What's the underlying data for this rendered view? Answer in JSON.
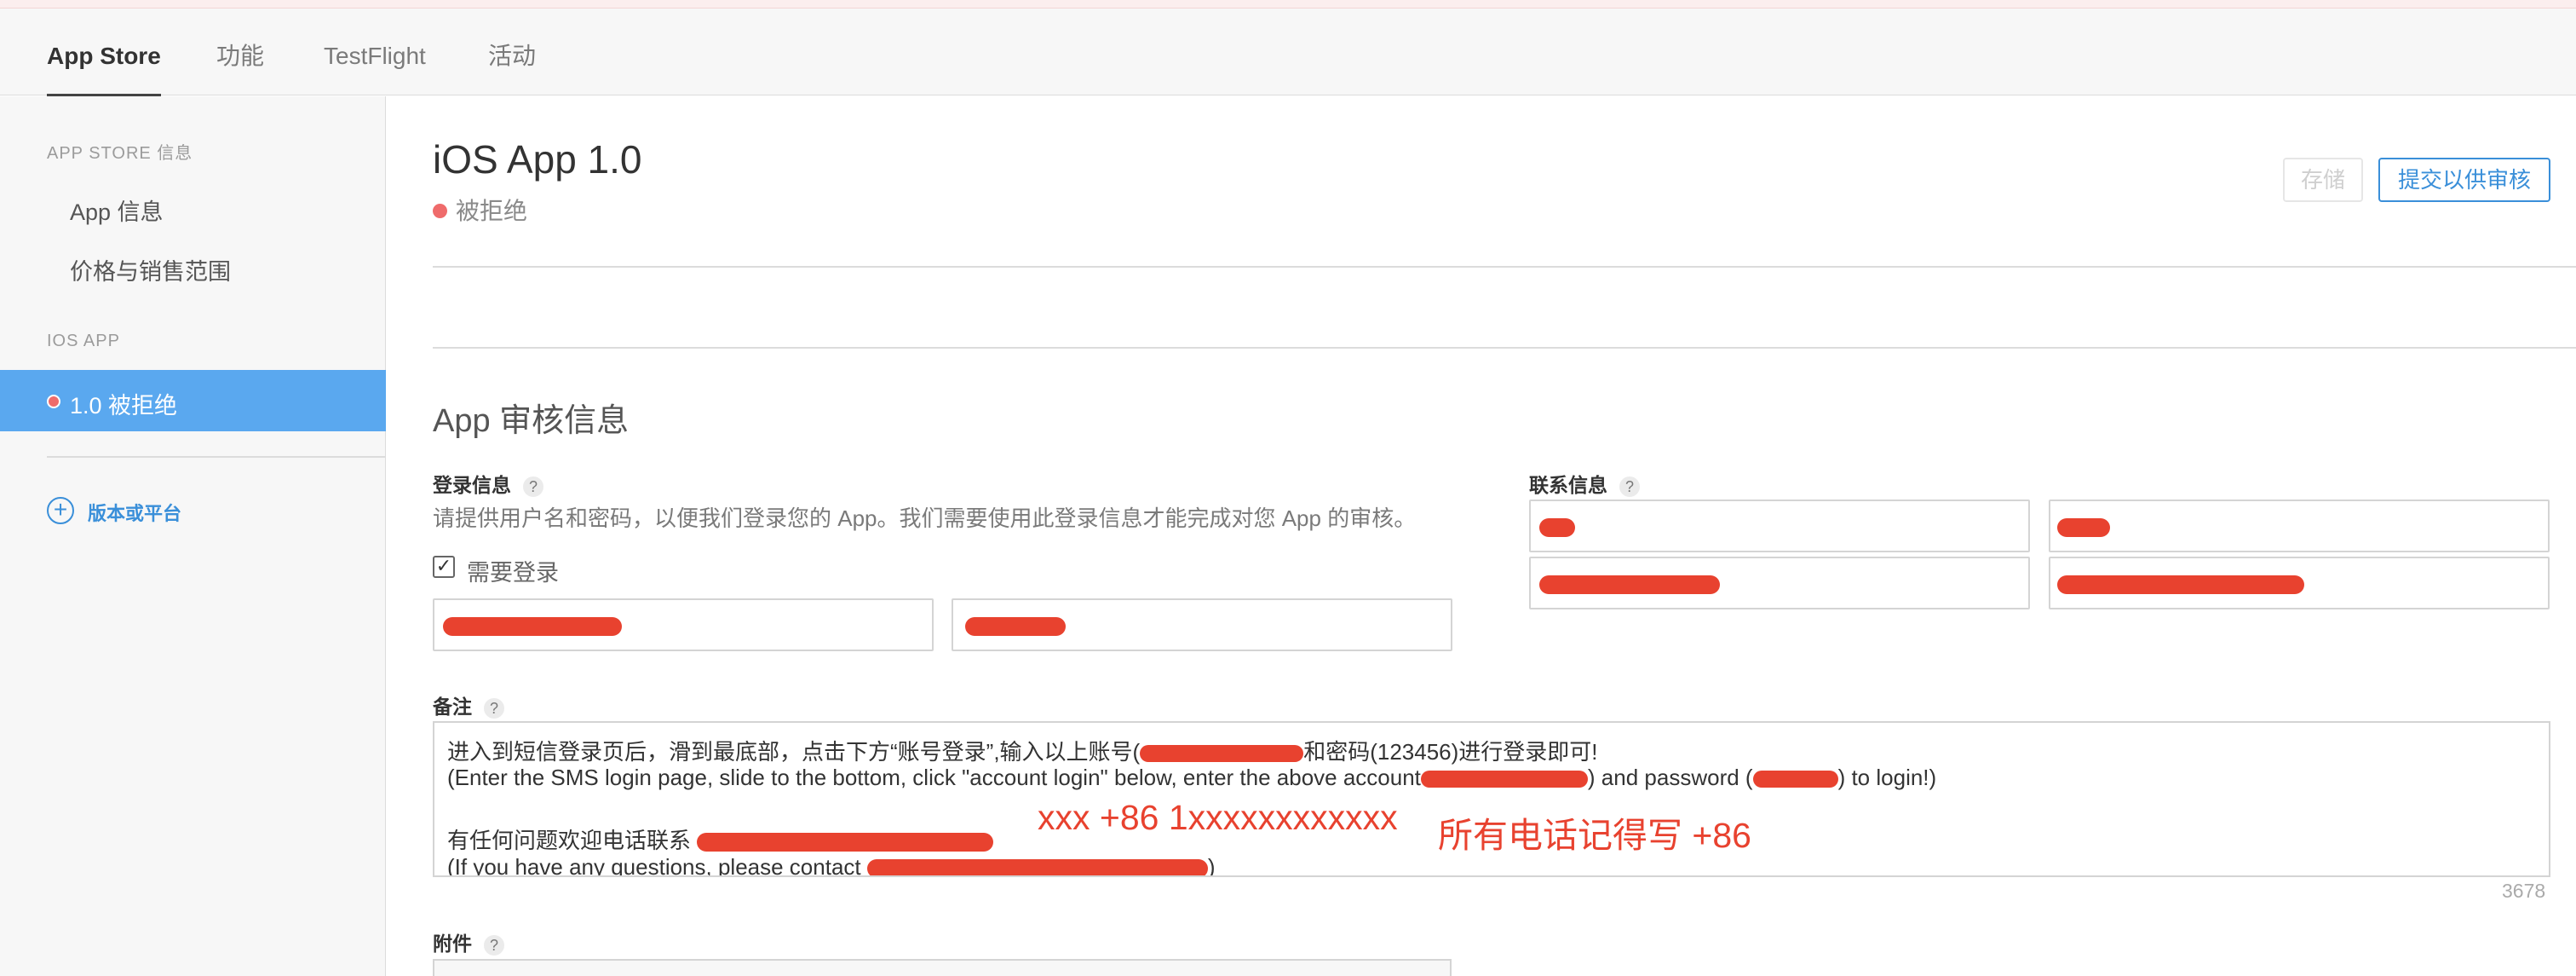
{
  "tabs": [
    {
      "label": "App Store",
      "active": true
    },
    {
      "label": "功能",
      "active": false
    },
    {
      "label": "TestFlight",
      "active": false
    },
    {
      "label": "活动",
      "active": false
    }
  ],
  "sidebar": {
    "section1_heading": "APP STORE 信息",
    "items": [
      "App 信息",
      "价格与销售范围"
    ],
    "section2_heading": "IOS APP",
    "active_item": "1.0 被拒绝",
    "add_label": "版本或平台"
  },
  "header": {
    "title": "iOS App 1.0",
    "status": "被拒绝",
    "status_color": "#ef6b6b",
    "save_label": "存储",
    "submit_label": "提交以供审核"
  },
  "review": {
    "section_title": "App 审核信息",
    "login_label": "登录信息",
    "login_desc": "请提供用户名和密码，以便我们登录您的 App。我们需要使用此登录信息才能完成对您 App 的审核。",
    "require_login_label": "需要登录",
    "require_login_checked": true,
    "contact_label": "联系信息",
    "notes_label": "备注",
    "notes_lines": [
      "进入到短信登录页后，滑到最底部，点击下方“账号登录”,输入以上账号(",
      "和密码(123456)进行登录即可!",
      "(Enter the SMS login page, slide to the bottom, click \"account login\" below, enter the above account",
      ") and password (",
      ") to login!)",
      "有任何问题欢迎电话联系",
      "(If you have any questions, please contact",
      ")"
    ],
    "char_count": "3678",
    "attach_label": "附件"
  },
  "annotations": {
    "phone_format": "xxx +86 1xxxxxxxxxxxx",
    "phone_note": "所有电话记得写 +86",
    "color": "#e8422f"
  },
  "colors": {
    "accent": "#3a8fd9",
    "sidebar_active_bg": "#5aa8ef",
    "redaction": "#e8422f"
  }
}
